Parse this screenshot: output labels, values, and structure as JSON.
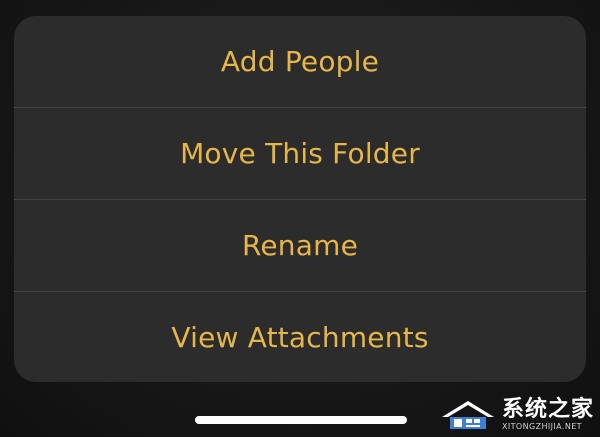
{
  "action_sheet": {
    "items": [
      {
        "label": "Add People"
      },
      {
        "label": "Move This Folder"
      },
      {
        "label": "Rename"
      },
      {
        "label": "View Attachments"
      }
    ]
  },
  "watermark": {
    "title": "系统之家",
    "subtitle": "XITONGZHIJIA.NET"
  },
  "colors": {
    "accent": "#e6b648",
    "sheet_background": "#2c2c2c",
    "divider": "#444444"
  }
}
